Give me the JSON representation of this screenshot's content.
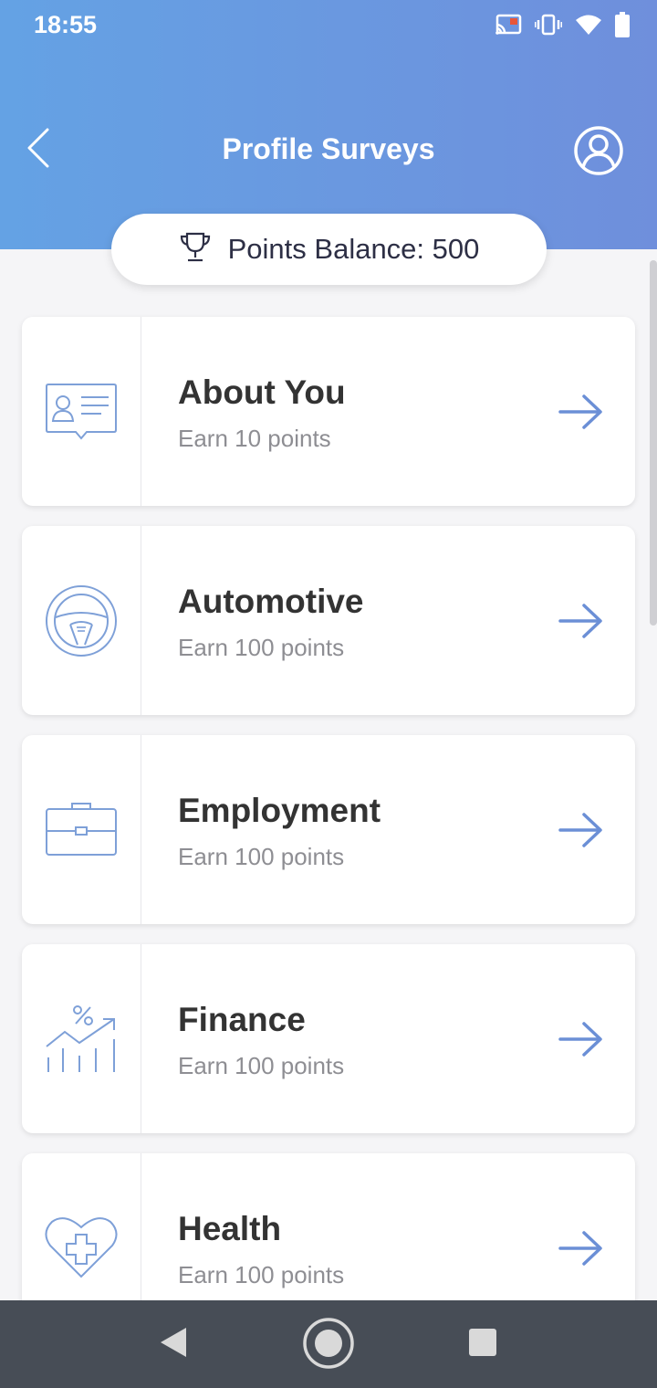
{
  "status_bar": {
    "time": "18:55",
    "icons": [
      "cast-icon",
      "vibrate-icon",
      "wifi-icon",
      "battery-icon"
    ]
  },
  "header": {
    "title": "Profile Surveys",
    "back_icon": "chevron-left-icon",
    "profile_icon": "user-circle-icon",
    "gradient_start": "#64a2e4",
    "gradient_end": "#6f8fdc"
  },
  "balance": {
    "icon": "trophy-icon",
    "label": "Points Balance: 500"
  },
  "surveys": [
    {
      "title": "About You",
      "subtitle": "Earn 10 points",
      "icon": "id-card-icon"
    },
    {
      "title": "Automotive",
      "subtitle": "Earn 100 points",
      "icon": "steering-wheel-icon"
    },
    {
      "title": "Employment",
      "subtitle": "Earn 100 points",
      "icon": "briefcase-icon"
    },
    {
      "title": "Finance",
      "subtitle": "Earn 100 points",
      "icon": "growth-chart-icon"
    },
    {
      "title": "Health",
      "subtitle": "Earn 100 points",
      "icon": "heart-plus-icon"
    }
  ],
  "colors": {
    "accent": "#6b8fd6",
    "icon_stroke": "#7ea0d8",
    "title_text": "#333333",
    "subtitle_text": "#8e8e93",
    "nav_bar": "#474d56"
  },
  "nav_bar": {
    "buttons": [
      "back-triangle-icon",
      "home-circle-icon",
      "recents-square-icon"
    ]
  }
}
